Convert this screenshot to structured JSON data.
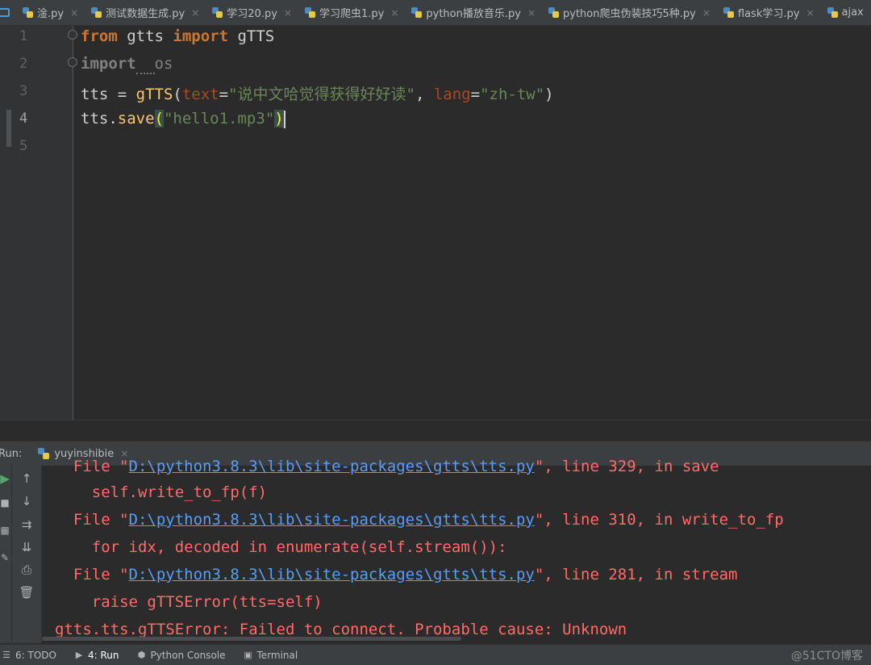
{
  "tabs": [
    {
      "label": "淦.py"
    },
    {
      "label": "测试数据生成.py"
    },
    {
      "label": "学习20.py"
    },
    {
      "label": "学习爬虫1.py"
    },
    {
      "label": "python播放音乐.py"
    },
    {
      "label": "python爬虫伪装技巧5种.py"
    },
    {
      "label": "flask学习.py"
    },
    {
      "label": "ajax"
    }
  ],
  "tab_close_glyph": "×",
  "editor": {
    "line_numbers": [
      "1",
      "2",
      "3",
      "4",
      "5"
    ],
    "lines": {
      "l1": {
        "kw1": "from",
        "mod": " gtts ",
        "kw2": "import",
        "name": " gTTS"
      },
      "l2": {
        "kw": "import",
        "sp": "  ",
        "mod": "os"
      },
      "l3": {
        "var": "tts = ",
        "call": "gTTS",
        "open": "(",
        "p1": "text",
        "eq1": "=",
        "s1": "\"说中文哈觉得获得好好读\"",
        "comma": ", ",
        "p2": "lang",
        "eq2": "=",
        "s2": "\"zh-tw\"",
        "close": ")"
      },
      "l4": {
        "obj": "tts.",
        "method": "save",
        "open": "(",
        "s1": "\"hello1.mp3\"",
        "close": ")"
      }
    }
  },
  "run_panel": {
    "label": "Run:",
    "config_name": "yuyinshibie",
    "output": [
      {
        "pre": "  File \"",
        "link": "D:\\python3.8.3\\lib\\site-packages\\gtts\\tts.py",
        "post": "\", line 329, in save"
      },
      {
        "text": "    self.write_to_fp(f)"
      },
      {
        "pre": "  File \"",
        "link": "D:\\python3.8.3\\lib\\site-packages\\gtts\\tts.py",
        "post": "\", line 310, in write_to_fp"
      },
      {
        "text": "    for idx, decoded in enumerate(self.stream()):"
      },
      {
        "pre": "  File \"",
        "link": "D:\\python3.8.3\\lib\\site-packages\\gtts\\tts.py",
        "post": "\", line 281, in stream"
      },
      {
        "text": "    raise gTTSError(tts=self)"
      },
      {
        "text": "gtts.tts.gTTSError: Failed to connect. Probable cause: Unknown"
      }
    ]
  },
  "bottom_bar": {
    "items": [
      {
        "label": "6: TODO",
        "icon": "todo-icon"
      },
      {
        "label": "4: Run",
        "icon": "run-icon"
      },
      {
        "label": "Python Console",
        "icon": "python-console-icon"
      },
      {
        "label": "Terminal",
        "icon": "terminal-icon"
      }
    ],
    "watermark": "@51CTO博客"
  },
  "colors": {
    "keyword": "#cc7832",
    "string": "#6a8759",
    "function": "#ffc66d",
    "error": "#ff6b68",
    "link": "#589df6"
  }
}
